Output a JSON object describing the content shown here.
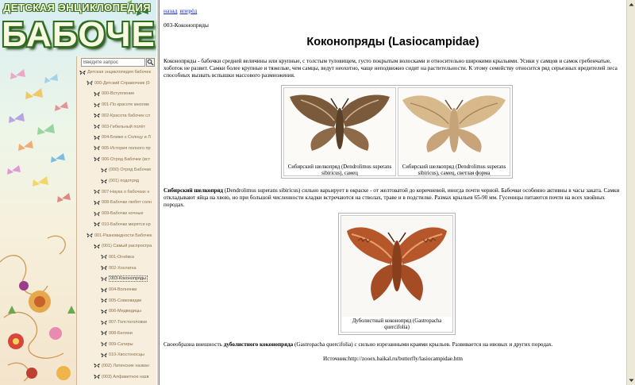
{
  "logo": {
    "top_line": "ДЕТСКАЯ ЭНЦИКЛОПЕДИЯ",
    "big_line": "БАБОЧЕК"
  },
  "search": {
    "value": "Введите запрос"
  },
  "tree": [
    {
      "label": "Детская энциклопедия бабочек",
      "level": 0
    },
    {
      "label": "000-Детский Справочник (0",
      "level": 1
    },
    {
      "label": "000-Вступление",
      "level": 2
    },
    {
      "label": "001-По красоте многим",
      "level": 2
    },
    {
      "label": "002-Красота бабочек сл",
      "level": 2
    },
    {
      "label": "003-Гибельный полёт",
      "level": 2
    },
    {
      "label": "004-Ближе к Солнцу и Л",
      "level": 2
    },
    {
      "label": "005-История полного пр",
      "level": 2
    },
    {
      "label": "006-Отряд Бабочки (вст",
      "level": 2
    },
    {
      "label": "(000) Отряд Бабочки",
      "level": 3
    },
    {
      "label": "(001) подотряд",
      "level": 3
    },
    {
      "label": "007-Наука о бабочках н",
      "level": 2
    },
    {
      "label": "008-Бабочки любят солн",
      "level": 2
    },
    {
      "label": "009-Бабочки ночные",
      "level": 2
    },
    {
      "label": "010-Бабочки мерятся кр",
      "level": 2
    },
    {
      "label": "001-Разновидности Бабочек",
      "level": 1
    },
    {
      "label": "(001) Самый распростра",
      "level": 2
    },
    {
      "label": "001-Огнёвка",
      "level": 3
    },
    {
      "label": "002-Хохлатка",
      "level": 3
    },
    {
      "label": "003-Коконопряды",
      "level": 3
    },
    {
      "label": "004-Волнянки",
      "level": 3
    },
    {
      "label": "005-Совковидки",
      "level": 3
    },
    {
      "label": "006-Медведицы",
      "level": 3
    },
    {
      "label": "007-Толстоголовки",
      "level": 3
    },
    {
      "label": "008-Беляни",
      "level": 3
    },
    {
      "label": "009-Сатиры",
      "level": 3
    },
    {
      "label": "010-Хвостоносцы",
      "level": 3
    },
    {
      "label": "(002) Латинские назван",
      "level": 2
    },
    {
      "label": "(003) Алфавитное назв",
      "level": 2
    }
  ],
  "selected_index": 19,
  "content": {
    "nav": {
      "back": "назад",
      "forward": "вперёд"
    },
    "page_code": "003-Коконопряды",
    "title": "Коконопряды (Lasiocampidae)",
    "para1": "Коконопряды - бабочки средней величины или крупные, с толстым туловищем, густо покрытым волосками и относительно широкими крыльями. Усики у самцов и самок гребенчатые, хоботок не развит. Самки более крупные и тяжелые, чем самцы, ведут неохотно, чаще неподвижно сидят на растительности. К этому семейству относится ряд серьезных вредителей леса способных вызвать вспышки массового размножения.",
    "caption1": "Сибирский шелкопряд (Dendrolimus superans sibiricus), самец",
    "caption2": "Сибирский шелкопряд (Dendrolimus superans sibiricus), самец, светлая форма",
    "para2_bold": "Сибирский шелкопряд",
    "para2": " (Dendrolimus superans sibiricus) сильно варьирует в окраске - от желтоватой до коричневой, иногда почти черной. Бабочки особенно активны в часы заката. Самки откладывают яйца на хвою, но при большой численности кладки встречаются на стволах, траве и в подстилке. Размах крыльев 65-90 мм. Гусеницы питаются почти на всех хвойных породах.",
    "caption3": "Дуболистный коконопряд (Gastropacha quercifolia)",
    "para3_pre": "Своеобразна внешность ",
    "para3_bold": "дуболистного коконопряда",
    "para3": " (Gastropacha quercifolia) с сильно изрезанными краями крыльев. Развивается на ивовых и других породах.",
    "source": "Источник:http://zooex.baikal.ru/butterfly/lasiocampidae.htm"
  },
  "colors": {
    "link": "#1a2fbf",
    "tree_text": "#8a6f4a",
    "logo_green": "#2f6d1e"
  }
}
